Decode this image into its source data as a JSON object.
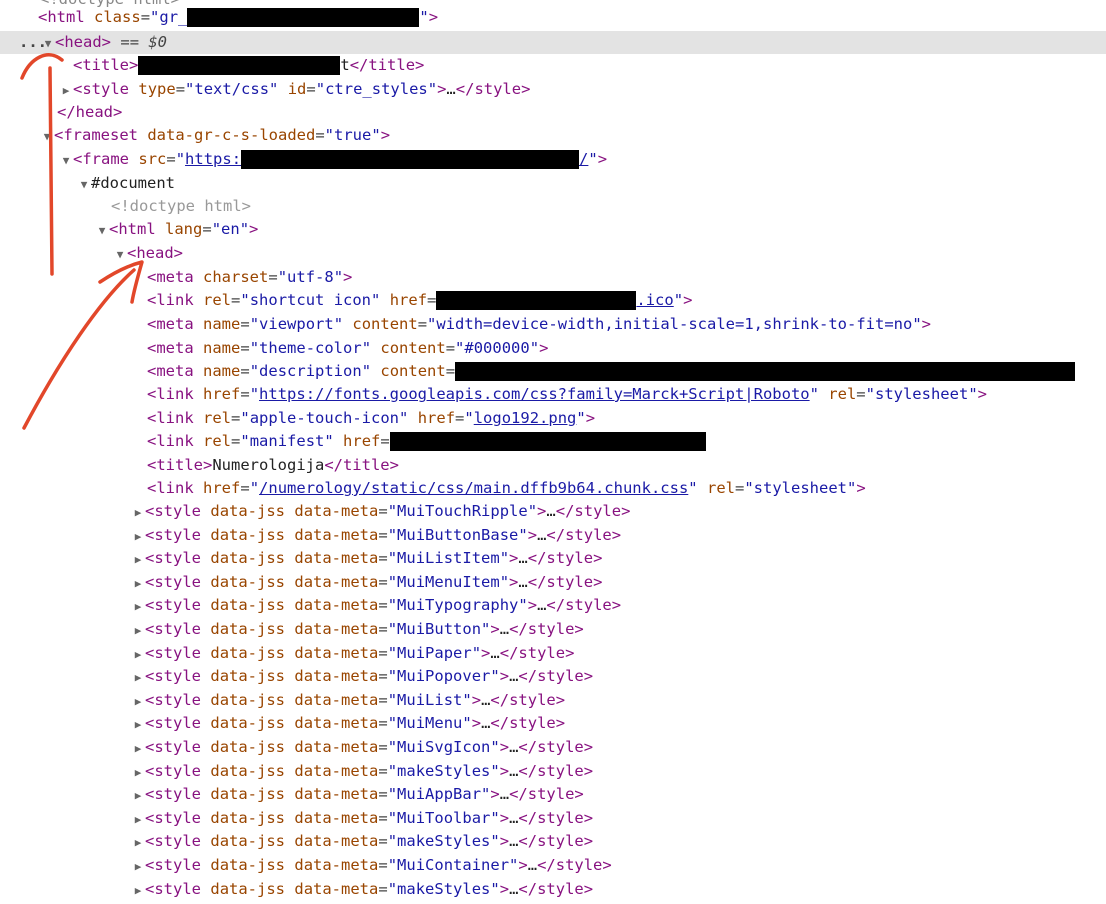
{
  "header": {
    "doctype_comment": "<!doctype html>",
    "html_open_tag": "html",
    "html_class_attr": "class",
    "html_class_prefix": "gr_",
    "head_tag": "head",
    "selected_marker": "== $0",
    "ellipsis": "..."
  },
  "outer_head": {
    "title_tag": "title",
    "title_suffix": "t",
    "style_tag": "style",
    "style_type_attr": "type",
    "style_type_val": "text/css",
    "style_id_attr": "id",
    "style_id_val": "ctre_styles",
    "head_close": "/head"
  },
  "frameset": {
    "tag": "frameset",
    "attr": "data-gr-c-s-loaded",
    "val": "true",
    "frame_tag": "frame",
    "frame_src_attr": "src",
    "frame_src_prefix": "https:",
    "frame_src_suffix": "/",
    "document_label": "#document",
    "inner_doctype": "<!doctype html>",
    "inner_html_tag": "html",
    "inner_lang_attr": "lang",
    "inner_lang_val": "en",
    "inner_head_tag": "head"
  },
  "inner_head": {
    "meta_charset_attr": "charset",
    "meta_charset_val": "utf-8",
    "link_rel_attr": "rel",
    "link_shortcut_val": "shortcut icon",
    "link_href_attr": "href",
    "link_ico_suffix": ".ico",
    "meta_name_attr": "name",
    "meta_content_attr": "content",
    "viewport_name": "viewport",
    "viewport_content": "width=device-width,initial-scale=1,shrink-to-fit=no",
    "theme_name": "theme-color",
    "theme_content": "#000000",
    "description_name": "description",
    "fonts_href": "https://fonts.googleapis.com/css?family=Marck+Script|Roboto",
    "stylesheet_val": "stylesheet",
    "apple_rel": "apple-touch-icon",
    "apple_href": "logo192.png",
    "manifest_rel": "manifest",
    "title_text": "Numerologija",
    "main_css_href": "/numerology/static/css/main.dffb9b64.chunk.css"
  },
  "styles": {
    "tag": "style",
    "jss_attr": "data-jss",
    "meta_attr": "data-meta",
    "items": [
      "MuiTouchRipple",
      "MuiButtonBase",
      "MuiListItem",
      "MuiMenuItem",
      "MuiTypography",
      "MuiButton",
      "MuiPaper",
      "MuiPopover",
      "MuiList",
      "MuiMenu",
      "MuiSvgIcon",
      "makeStyles",
      "MuiAppBar",
      "MuiToolbar",
      "makeStyles",
      "MuiContainer",
      "makeStyles"
    ]
  },
  "colors": {
    "tag": "#881280",
    "attr": "#994500",
    "value": "#1a1aa6",
    "annotation": "#e2472a",
    "selected_row": "#e3e3e3"
  }
}
